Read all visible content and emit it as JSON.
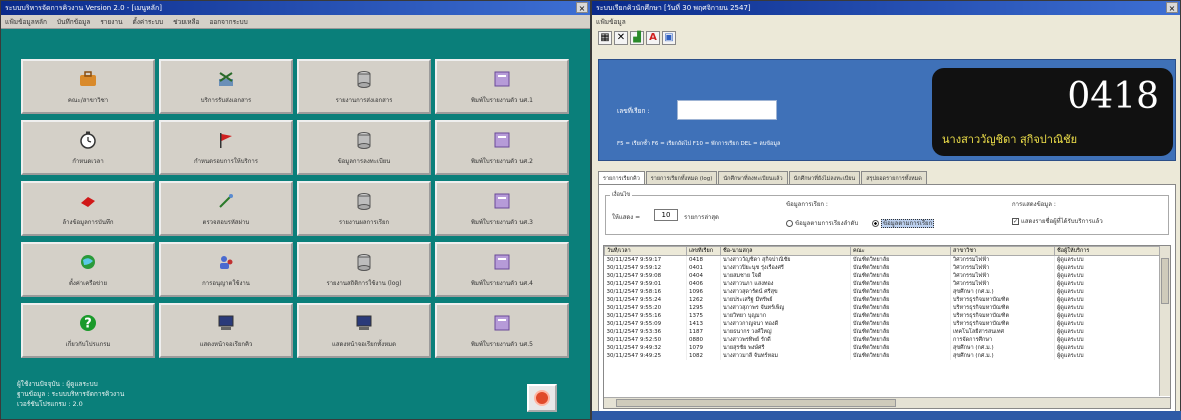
{
  "left_window": {
    "title": "ระบบบริหารจัดการคิวงาน Version 2.0 - [เมนูหลัก]",
    "menu": [
      "แฟ้มข้อมูลหลัก",
      "บันทึกข้อมูล",
      "รายงาน",
      "ตั้งค่าระบบ",
      "ช่วยเหลือ",
      "ออกจากระบบ"
    ],
    "tiles": [
      {
        "label": "คณะ/สาขาวิชา",
        "icon": "briefcase-icon"
      },
      {
        "label": "บริการรับส่งเอกสาร",
        "icon": "scissors-icon"
      },
      {
        "label": "รายงานการส่งเอกสาร",
        "icon": "database-icon"
      },
      {
        "label": "พิมพ์ใบรายงานตัว นศ.1",
        "icon": "document-purple-icon"
      },
      {
        "label": "กำหนดเวลา",
        "icon": "clock-icon"
      },
      {
        "label": "กำหนดรอบการให้บริการ",
        "icon": "flag-icon"
      },
      {
        "label": "ข้อมูลการลงทะเบียน",
        "icon": "database-icon"
      },
      {
        "label": "พิมพ์ใบรายงานตัว นศ.2",
        "icon": "document-purple-icon"
      },
      {
        "label": "ล้างข้อมูลการบันทึก",
        "icon": "eraser-icon"
      },
      {
        "label": "ตรวจสอบรหัสผ่าน",
        "icon": "tools-icon"
      },
      {
        "label": "รายงานผลการเรียก",
        "icon": "database-icon"
      },
      {
        "label": "พิมพ์ใบรายงานตัว นศ.3",
        "icon": "document-purple-icon"
      },
      {
        "label": "ตั้งค่าเครือข่าย",
        "icon": "globe-icon"
      },
      {
        "label": "การอนุญาตใช้งาน",
        "icon": "users-icon"
      },
      {
        "label": "รายงานสถิติการใช้งาน (log)",
        "icon": "database-icon"
      },
      {
        "label": "พิมพ์ใบรายงานตัว นศ.4",
        "icon": "document-purple-icon"
      },
      {
        "label": "เกี่ยวกับโปรแกรม",
        "icon": "help-icon"
      },
      {
        "label": "แสดงหน้าจอเรียกคิว",
        "icon": "monitor-icon"
      },
      {
        "label": "แสดงหน้าจอเรียกทั้งหมด",
        "icon": "monitor-icon"
      },
      {
        "label": "พิมพ์ใบรายงานตัว นศ.5",
        "icon": "document-purple-icon"
      }
    ],
    "footer_lines": [
      "ผู้ใช้งานปัจจุบัน : ผู้ดูแลระบบ",
      "ฐานข้อมูล : ระบบบริหารจัดการคิวงาน",
      "เวอร์ชันโปรแกรม : 2.0"
    ],
    "exit_icon": "exit-icon"
  },
  "right_window": {
    "title": "ระบบเรียกคิวนักศึกษา [วันที่ 30 พฤศจิกายน 2547]",
    "menu": [
      "แฟ้มข้อมูล"
    ],
    "toolbar_icons": [
      "grid-icon",
      "delete-icon",
      "chart-icon",
      "font-icon",
      "image-icon"
    ],
    "toolbar_font_glyph": "A",
    "header": {
      "number_label": "เลขที่เรียก :",
      "hint": "F5 = เรียกซ้ำ  F6 = เรียกถัดไป  F10 = พักการเรียก  DEL = ลบข้อมูล",
      "queue_number": "0418",
      "called_name": "นางสาววัญชิดา สุกิจปาณิชัย"
    },
    "tabs": [
      "รายการเรียกคิว",
      "รายการเรียกทั้งหมด (log)",
      "นักศึกษาที่ลงทะเบียนแล้ว",
      "นักศึกษาที่ยังไม่ลงทะเบียน",
      "สรุปยอดรายการทั้งหมด"
    ],
    "options": {
      "legend": "เงื่อนไข",
      "show_label": "ให้แสดง =",
      "show_count": "10",
      "show_suffix": "รายการล่าสุด",
      "sort_label": "ข้อมูลการเรียก :",
      "radio_1": "ข้อมูลตามการเรียงลำดับ",
      "radio_2": "ข้อมูลตามการเรียก",
      "display_label": "การแสดงข้อมูล :",
      "checkbox": "แสดงรายชื่อผู้ที่ได้รับบริการแล้ว"
    },
    "table": {
      "columns": [
        "วันที่/เวลา",
        "เลขที่เรียก",
        "ชื่อ-นามสกุล",
        "คณะ",
        "สาขาวิชา",
        "ชื่อผู้ให้บริการ"
      ],
      "rows": [
        [
          "30/11/2547 9:59:17",
          "0418",
          "นางสาววัญชิดา สุกิจปาณิชัย",
          "บัณฑิตวิทยาลัย",
          "วิศวกรรมไฟฟ้า",
          "ผู้ดูแลระบบ"
        ],
        [
          "30/11/2547 9:59:12",
          "0401",
          "นางสาวปิยะนุช รุ่งเรืองศรี",
          "บัณฑิตวิทยาลัย",
          "วิศวกรรมไฟฟ้า",
          "ผู้ดูแลระบบ"
        ],
        [
          "30/11/2547 9:59:08",
          "0404",
          "นายสมชาย ใจดี",
          "บัณฑิตวิทยาลัย",
          "วิศวกรรมไฟฟ้า",
          "ผู้ดูแลระบบ"
        ],
        [
          "30/11/2547 9:59:01",
          "0406",
          "นางสาวนภา แสงทอง",
          "บัณฑิตวิทยาลัย",
          "วิศวกรรมไฟฟ้า",
          "ผู้ดูแลระบบ"
        ],
        [
          "30/11/2547 9:58:16",
          "1096",
          "นางสาวสุดารัตน์ ศรีสุข",
          "บัณฑิตวิทยาลัย",
          "สุขศึกษา (กศ.ม.)",
          "ผู้ดูแลระบบ"
        ],
        [
          "30/11/2547 9:55:24",
          "1262",
          "นายประเสริฐ มีทรัพย์",
          "บัณฑิตวิทยาลัย",
          "บริหารธุรกิจมหาบัณฑิต",
          "ผู้ดูแลระบบ"
        ],
        [
          "30/11/2547 9:55:20",
          "1295",
          "นางสาวสุภาพร จันทร์เพ็ญ",
          "บัณฑิตวิทยาลัย",
          "บริหารธุรกิจมหาบัณฑิต",
          "ผู้ดูแลระบบ"
        ],
        [
          "30/11/2547 9:55:16",
          "1375",
          "นายวิทยา บุญมาก",
          "บัณฑิตวิทยาลัย",
          "บริหารธุรกิจมหาบัณฑิต",
          "ผู้ดูแลระบบ"
        ],
        [
          "30/11/2547 9:55:09",
          "1413",
          "นางสาวกาญจนา ทองดี",
          "บัณฑิตวิทยาลัย",
          "บริหารธุรกิจมหาบัณฑิต",
          "ผู้ดูแลระบบ"
        ],
        [
          "30/11/2547 9:53:36",
          "1187",
          "นายธนากร วงศ์ใหญ่",
          "บัณฑิตวิทยาลัย",
          "เทคโนโลยีสารสนเทศ",
          "ผู้ดูแลระบบ"
        ],
        [
          "30/11/2547 9:52:50",
          "0880",
          "นางสาวพรทิพย์ รักดี",
          "บัณฑิตวิทยาลัย",
          "การจัดการศึกษา",
          "ผู้ดูแลระบบ"
        ],
        [
          "30/11/2547 9:49:32",
          "1079",
          "นายสุรชัย พงษ์ศรี",
          "บัณฑิตวิทยาลัย",
          "สุขศึกษา (กศ.ม.)",
          "ผู้ดูแลระบบ"
        ],
        [
          "30/11/2547 9:49:25",
          "1082",
          "นางสาวมาลี จันทร์หอม",
          "บัณฑิตวิทยาลัย",
          "สุขศึกษา (กศ.ม.)",
          "ผู้ดูแลระบบ"
        ]
      ]
    }
  },
  "colors": {
    "left_bg": "#0a7f7a",
    "tile_bg": "#d4d0c8",
    "header_blue": "#3f71b8",
    "display_bg": "#111111",
    "display_name": "#f0e14a"
  }
}
